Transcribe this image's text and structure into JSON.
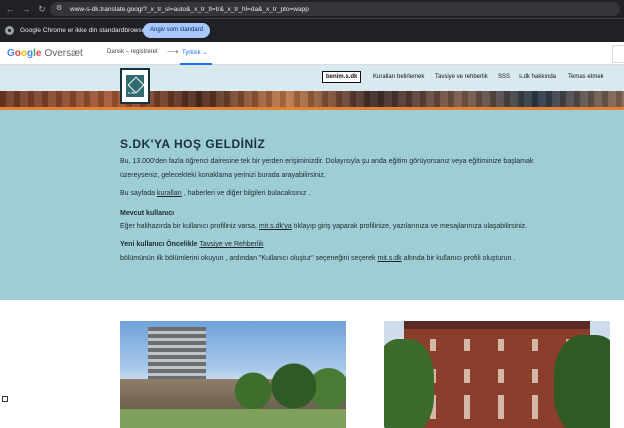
{
  "browser": {
    "url": "www-s-dk.translate.goog/?_x_tr_sl=auto&_x_tr_tl=tr&_x_tr_hl=da&_x_tr_pto=wapp",
    "info_text": "Google Chrome er ikke din standardbrowser",
    "default_button": "Angiv som standard"
  },
  "translate": {
    "logo_letters": [
      "G",
      "o",
      "o",
      "g",
      "l",
      "e"
    ],
    "logo_colors": [
      "#4285f4",
      "#ea4335",
      "#fbbc05",
      "#4285f4",
      "#34a853",
      "#ea4335"
    ],
    "product": "Oversæt",
    "source_lang": "Dansk – registreret",
    "arrow": "⟶",
    "target_lang": "Tyrkisk ⌄"
  },
  "site": {
    "nav": [
      "benim.s.dk",
      "Kuralları belirlemek",
      "Tavsiye ve rehberlik",
      "SSS",
      "s.dk hakkında",
      "Temas etmek"
    ]
  },
  "welcome": {
    "title": "S.DK'YA HOŞ GELDİNİZ",
    "p1_line1": "Bu, 13.000'den fazla öğrenci dairesine tek bir yerden erişiminizdir. Dolayısıyla şu anda eğitim görüyorsanız veya eğitiminize başlamak",
    "p1_line2": "üzereyseniz, gelecekteki konaklama yerinizi burada arayabilirsiniz.",
    "p2_pre": "Bu sayfada ",
    "p2_link": "kuralları",
    "p2_post": " , haberleri ve diğer bilgileri bulacaksınız .",
    "existing_heading": "Mevcut kullanıcı",
    "existing_pre": "Eğer halihazırda bir kullanıcı profiliniz varsa, ",
    "existing_link": "mit.s.dk'ya",
    "existing_post": " tıklayıp giriş yaparak profilinize, yazılarınıza ve mesajlarınıza ulaşabilirsiniz.",
    "new_heading": "Yeni kullanıcı Öncelikle ",
    "new_link": "Tavsiye ve Rehberlik",
    "new_line2_pre": "bölümünün ilk bölümlerini okuyun  , ardından \"Kullanıcı oluştur\" seçeneğini seçerek ",
    "new_line2_link": "mit.s.dk",
    "new_line2_post": " altında bir kullanıcı profili oluşturun ."
  },
  "colors": {
    "welcome_bg": "#9ecdd5",
    "accent": "#e8812f",
    "title": "#15343a"
  }
}
